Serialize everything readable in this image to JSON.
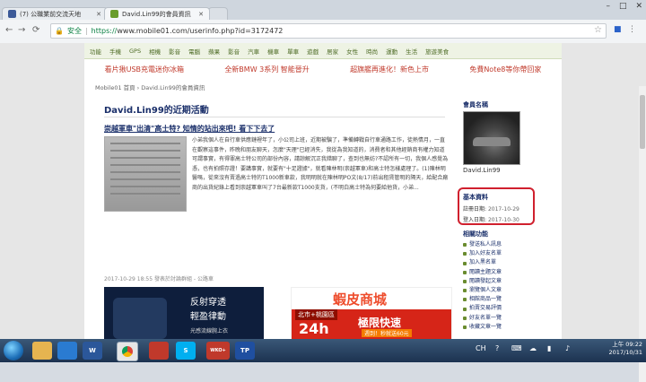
{
  "browser": {
    "tabs": [
      {
        "title": "(7) 公職業前交流天地",
        "fav_color": "#3b5998",
        "fav_icon": "facebook-icon"
      },
      {
        "title": "David.Lin99的會員資訊",
        "fav_color": "#6a9d2c",
        "fav_icon": "mobile01-icon"
      }
    ],
    "security_label": "安全",
    "url_scheme": "https://",
    "url_rest": "www.mobile01.com/userinfo.php?id=3172472"
  },
  "site": {
    "categories": [
      "功能",
      "手機",
      "GPS",
      "相機",
      "影音",
      "電腦",
      "蘋果",
      "影音",
      "汽車",
      "機車",
      "單車",
      "遊戲",
      "居家",
      "女性",
      "時尚",
      "運動",
      "生活",
      "旅遊美食"
    ],
    "promos": [
      "看片揪USB充電迷你冰箱",
      "全新BMW 3系列 智能晉升",
      "超旗艦再進化！新色上市",
      "免費Note8等你帶回家"
    ],
    "breadcrumb": [
      "Mobile01 首頁",
      "David.Lin99的會員資訊"
    ]
  },
  "main": {
    "activity_title": "David.Lin99的近期活動",
    "post_title": "崇越軍車\"出清\"高士特? 知情的站出來吧! 看下下去了",
    "excerpt": "小弟我個人在自行車供應鏈裡年了，小公司上班，近期被騙了，準備轉戰自行車通路工作，徒熱情月，一直在觀察這事件，昨晚和朋友聊天，怎麼\"天理\"已經消失，我從為我知道的，消費者和其他經銷商有權力知道可謂事實，有得罪高士特公司的部份內容，請諒解沉正我錯聊了，查到也無妨?不認所有一切，我個人感覺為憑，也有拍照存證！要講事實，就要有\"十足證據\"，就看陳林明(崇越軍車)和高士特怎樣處理了。(1)陳林明醫嗎，從來沒有賣過高士特的T1000新車款，我明明就在陳林明PO文(8/17)前出租賃管明的隔天，給配合廠商的出貨紀錄上看到崇越軍車叫了7台最新款T1000支貨，(不明白高士特為何要給他貨，小弟...",
    "meta": "2017-10-29 18:55 發表於討論群組 - 公路車",
    "ad1": {
      "line1": "反射穿透",
      "line2": "輕盈律動",
      "line3": "光感流線腕上衣"
    },
    "ad2": {
      "brand": "蝦皮商城",
      "loc": "北市+桃園區",
      "big": "24h",
      "fast": "極限快速",
      "sub": "週到！秒就送60元"
    }
  },
  "sidebar": {
    "member_title": "會員名稱",
    "username": "David.Lin99",
    "basic_title": "基本資料",
    "register_label": "註冊日期:",
    "register_value": "2017-10-29",
    "login_label": "登入日期:",
    "login_value": "2017-10-30",
    "links_title": "相關功能",
    "links": [
      "發送私人訊息",
      "加入好友名單",
      "加入黑名單",
      "閱讀主題文章",
      "閱讀發起文章",
      "瀏覽個人文章",
      "相館商品一覽",
      "拍賣交易評價",
      "好友名單一覽",
      "收藏文章一覽"
    ]
  },
  "taskbar": {
    "apps": [
      {
        "icon": "folder-icon",
        "color": "#e6b450",
        "label": ""
      },
      {
        "icon": "media-player-icon",
        "color": "#2a7bd1",
        "label": ""
      },
      {
        "icon": "word-icon",
        "color": "#2b579a",
        "label": "W"
      },
      {
        "icon": "chrome-icon",
        "color": "#e6e6e6",
        "label": ""
      },
      {
        "icon": "app-red-icon",
        "color": "#c0392b",
        "label": ""
      },
      {
        "icon": "skype-icon",
        "color": "#00aff0",
        "label": "S"
      },
      {
        "icon": "wko-icon",
        "color": "#c0392b",
        "label": "WKO+"
      },
      {
        "icon": "tp-icon",
        "color": "#1f4fa0",
        "label": "TP"
      }
    ],
    "lang": "CH",
    "time": "上午 09:22",
    "date": "2017/10/31"
  }
}
